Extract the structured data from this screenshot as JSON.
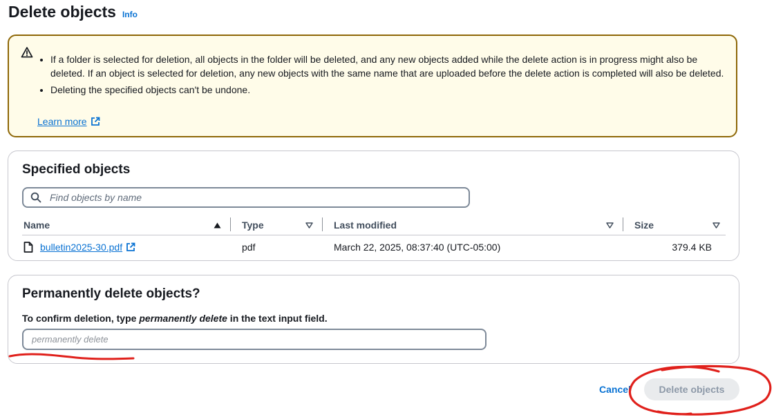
{
  "header": {
    "title": "Delete objects",
    "info_label": "Info"
  },
  "alert": {
    "bullets": [
      "If a folder is selected for deletion, all objects in the folder will be deleted, and any new objects added while the delete action is in progress might also be deleted. If an object is selected for deletion, any new objects with the same name that are uploaded before the delete action is completed will also be deleted.",
      "Deleting the specified objects can't be undone."
    ],
    "learn_more": "Learn more",
    "icon": "warning-icon",
    "border_color": "#8d6605",
    "background_color": "#fffce9"
  },
  "specified": {
    "title": "Specified objects",
    "search_placeholder": "Find objects by name",
    "columns": [
      "Name",
      "Type",
      "Last modified",
      "Size"
    ],
    "rows": [
      {
        "name": "bulletin2025-30.pdf",
        "type": "pdf",
        "last_modified": "March 22, 2025, 08:37:40 (UTC-05:00)",
        "size": "379.4 KB"
      }
    ]
  },
  "permanent": {
    "title": "Permanently delete objects?",
    "instruction_prefix": "To confirm deletion, type ",
    "instruction_em": "permanently delete",
    "instruction_suffix": " in the text input field.",
    "input_placeholder": "permanently delete"
  },
  "footer": {
    "cancel_label": "Cancel",
    "delete_label": "Delete objects"
  },
  "colors": {
    "link": "#0972d3",
    "annotation": "#e0201b",
    "disabled_button_bg": "#e9ebed"
  }
}
